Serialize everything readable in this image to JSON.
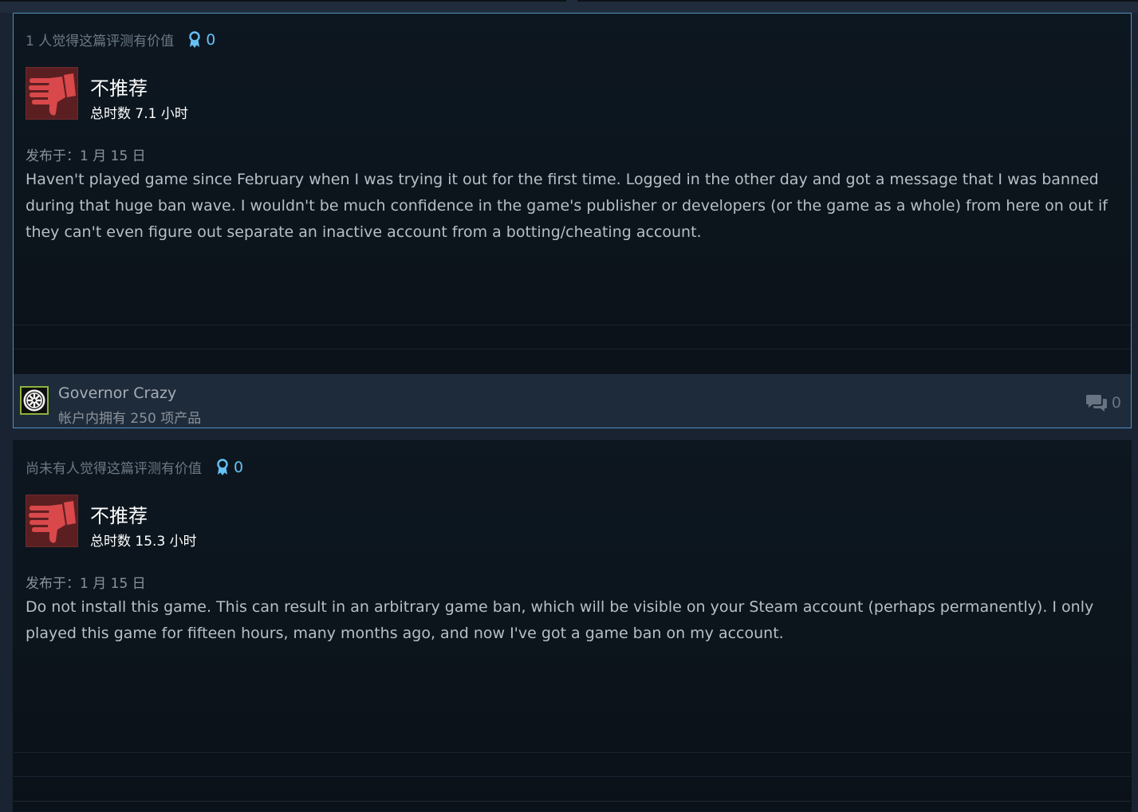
{
  "colors": {
    "accent": "#66c0f4",
    "thumb_down": "#d9484b",
    "card_border": "#4f90c4",
    "author_bar": "#1e2b3b",
    "avatar_frame": "#8db43b"
  },
  "reviews": [
    {
      "helpful_text": "1 人觉得这篇评测有价值",
      "award_count": "0",
      "verdict": "不推荐",
      "hours": "总时数 7.1 小时",
      "posted": "发布于：1 月 15 日",
      "body": "Haven't played game since February when I was trying it out for the first time. Logged in the other day and got a message that I was banned during that huge ban wave. I wouldn't be much confidence in the game's publisher or developers (or the game as a whole) from here on out if they can't even figure out separate an inactive account from a botting/cheating account.",
      "author": {
        "name": "Governor Crazy",
        "products": "帐户内拥有 250 项产品",
        "avatar_icon": "galactic-empire-emblem-icon"
      },
      "comment_count": "0"
    },
    {
      "helpful_text": "尚未有人觉得这篇评测有价值",
      "award_count": "0",
      "verdict": "不推荐",
      "hours": "总时数 15.3 小时",
      "posted": "发布于：1 月 15 日",
      "body": "Do not install this game. This can result in an arbitrary game ban, which will be visible on your Steam account (perhaps permanently). I only played this game for fifteen hours, many months ago, and now I've got a game ban on my account."
    }
  ]
}
